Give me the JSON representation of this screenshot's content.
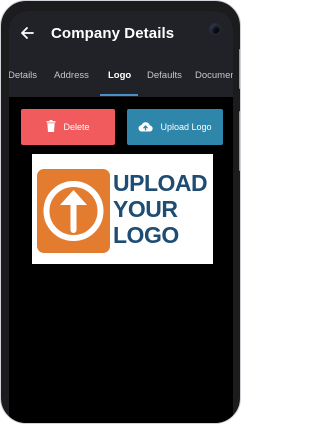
{
  "appbar": {
    "title": "Company Details",
    "back_icon": "arrow-left-icon"
  },
  "tabs": [
    {
      "label": "Details",
      "active": false
    },
    {
      "label": "Address",
      "active": false
    },
    {
      "label": "Logo",
      "active": true
    },
    {
      "label": "Defaults",
      "active": false
    },
    {
      "label": "Documents",
      "active": false
    }
  ],
  "actions": {
    "delete_label": "Delete",
    "delete_icon": "trash-icon",
    "upload_label": "Upload Logo",
    "upload_icon": "cloud-upload-icon"
  },
  "logo": {
    "lines": [
      "UPLOAD",
      "YOUR",
      "LOGO"
    ]
  },
  "colors": {
    "appbar_bg": "#212227",
    "delete": "#f25b5d",
    "upload": "#2f86ab",
    "tab_indicator": "#4a90c7",
    "logo_orange": "#e37c2f",
    "logo_blue": "#1f4c73"
  }
}
